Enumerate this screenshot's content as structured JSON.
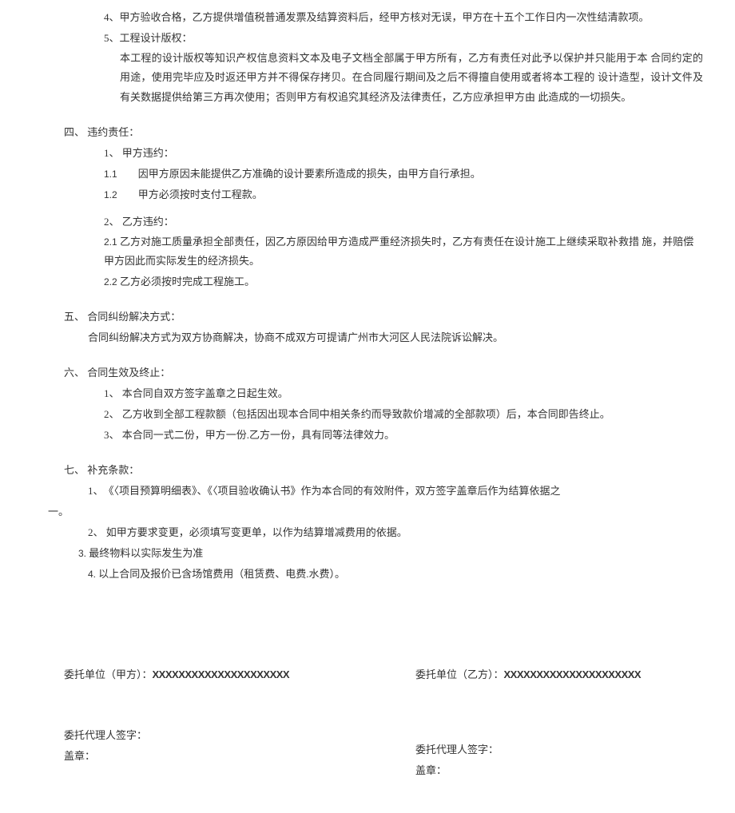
{
  "items": {
    "i4": "4、甲方验收合格，乙方提供增值税普通发票及结算资料后，经甲方核对无误，甲方在十五个工作日内一次性结清款项。",
    "i5_label": "5、工程设计版权：",
    "i5_body": "本工程的设计版权等知识产权信息资料文本及电子文档全部属于甲方所有，乙方有责任对此予以保护并只能用于本 合同约定的用途，使用完毕应及时返还甲方并不得保存拷贝。在合同履行期间及之后不得擅自使用或者将本工程的 设计造型，设计文件及有关数据提供给第三方再次使用；否则甲方有权追究其经济及法律责任，乙方应承担甲方由 此造成的一切损失。"
  },
  "s4": {
    "title": "四、 违约责任：",
    "a1": "1、 甲方违约：",
    "a11_num": "1.1",
    "a11_txt": "因甲方原因未能提供乙方准确的设计要素所造成的损失，由甲方自行承担。",
    "a12_num": "1.2",
    "a12_txt": "甲方必须按时支付工程款。",
    "b2": "2、 乙方违约：",
    "b21_num": "2.1",
    "b21_txt": "乙方对施工质量承担全部责任，因乙方原因给甲方造成严重经济损失时，乙方有责任在设计施工上继续采取补救措 施，并赔偿甲方因此而实际发生的经济损失。",
    "b22_num": "2.2",
    "b22_txt": "乙方必须按时完成工程施工。"
  },
  "s5": {
    "title": "五、 合同纠纷解决方式：",
    "body": "合同纠纷解决方式为双方协商解决，协商不成双方可提请广州市大河区人民法院诉讼解决。"
  },
  "s6": {
    "title": "六、 合同生效及终止：",
    "l1": "1、 本合同自双方签字盖章之日起生效。",
    "l2": "2、 乙方收到全部工程款额（包括因出现本合同中相关条约而导致款价增减的全部款项）后，本合同即告终止。",
    "l3": "3、 本合同一式二份，甲方一份.乙方一份，具有同等法律效力。"
  },
  "s7": {
    "title": "七、 补充条款：",
    "l1a": "1、　《〈项目预算明细表》、《〈项目验收确认书》作为本合同的有效附件，双方签字盖章后作为结算依据之",
    "l1b": "一。",
    "l2": "2、 如甲方要求变更，必须填写变更单，以作为结算增减费用的依据。",
    "l3": "3. 最终物料以实际发生为准",
    "l4": "4.  以上合同及报价已含场馆费用（租赁费、电费.水费）。"
  },
  "sig": {
    "jia_label": "委托单位（甲方）：",
    "jia_x": "XXXXXXXXXXXXXXXXXXXXX",
    "yi_label": "委托单位（乙方）：",
    "yi_x": "XXXXXXXXXXXXXXXXXXXXX",
    "agent": "委托代理人签字：",
    "seal": "盖章："
  }
}
